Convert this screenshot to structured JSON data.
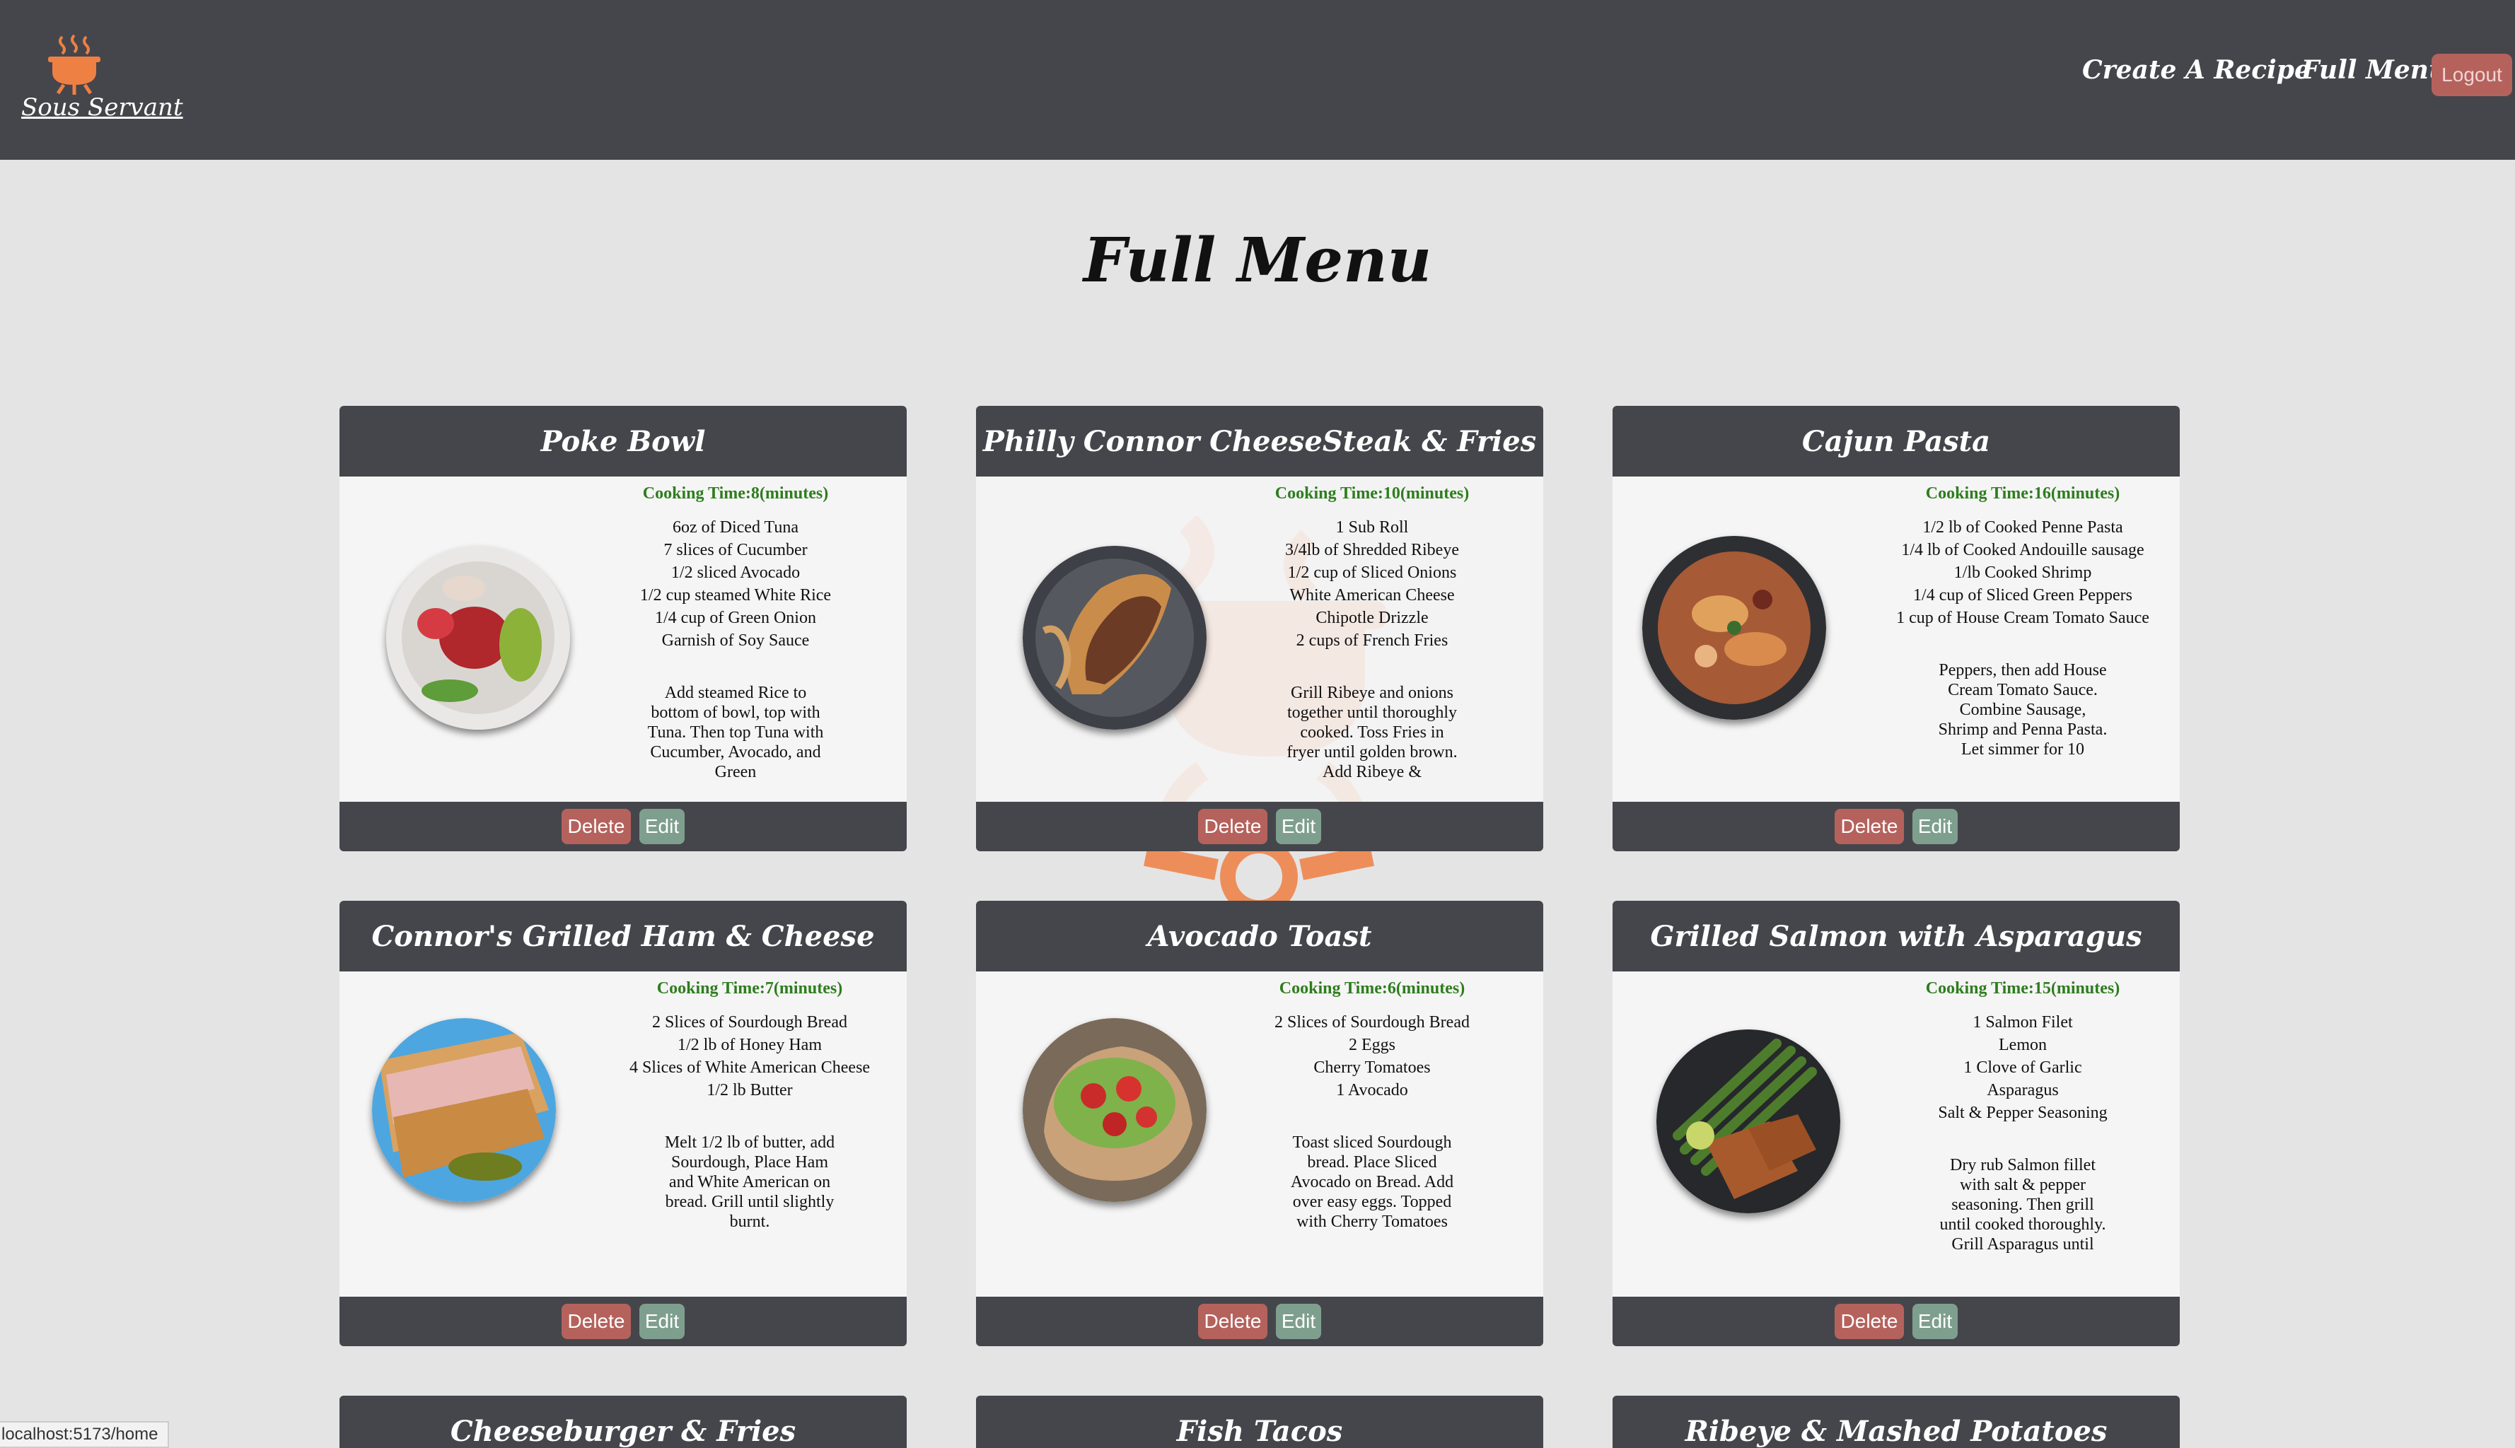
{
  "navbar": {
    "brand": "Sous Servant",
    "links": [
      "Create A Recipe",
      "Full Menu"
    ],
    "logout": "Logout"
  },
  "page": {
    "title": "Full Menu"
  },
  "colors": {
    "navbar": "#45464b",
    "accent": "#ef8043",
    "delete": "#b5625d",
    "edit": "#7f9f8e",
    "cooking_time": "#2e7d1e"
  },
  "buttons": {
    "delete": "Delete",
    "edit": "Edit"
  },
  "recipes": [
    {
      "title": "Poke Bowl",
      "cooking_time": "Cooking Time:8(minutes)",
      "ingredients": [
        "6oz of Diced Tuna",
        "7 slices of Cucumber",
        "1/2 sliced Avocado",
        "1/2 cup steamed White Rice",
        "1/4 cup of Green Onion",
        "Garnish of Soy Sauce"
      ],
      "instructions": "Add steamed Rice to bottom of bowl, top with Tuna. Then top Tuna with Cucumber, Avocado, and Green"
    },
    {
      "title": "Philly Connor CheeseSteak & Fries",
      "cooking_time": "Cooking Time:10(minutes)",
      "ingredients": [
        "1 Sub Roll",
        "3/4lb of Shredded Ribeye",
        "1/2 cup of Sliced Onions",
        "White American Cheese",
        "Chipotle Drizzle",
        "2 cups of French Fries"
      ],
      "instructions": "Grill Ribeye and onions together until thoroughly cooked. Toss Fries in fryer until golden brown. Add Ribeye &"
    },
    {
      "title": "Cajun Pasta",
      "cooking_time": "Cooking Time:16(minutes)",
      "ingredients": [
        "1/2 lb of Cooked Penne Pasta",
        "1/4 lb of Cooked Andouille sausage",
        "1/lb Cooked Shrimp",
        "1/4 cup of Sliced Green Peppers",
        "1 cup of House Cream Tomato Sauce"
      ],
      "instructions": "Peppers, then add House Cream Tomato Sauce. Combine Sausage, Shrimp and Penna Pasta. Let simmer for 10"
    },
    {
      "title": "Connor's Grilled Ham & Cheese",
      "cooking_time": "Cooking Time:7(minutes)",
      "ingredients": [
        "2 Slices of Sourdough Bread",
        "1/2 lb of Honey Ham",
        "4 Slices of White American Cheese",
        "1/2 lb Butter"
      ],
      "instructions": "Melt 1/2 lb of butter, add Sourdough, Place Ham and White American on bread. Grill until slightly burnt."
    },
    {
      "title": "Avocado Toast",
      "cooking_time": "Cooking Time:6(minutes)",
      "ingredients": [
        "2 Slices of Sourdough Bread",
        "2 Eggs",
        "Cherry Tomatoes",
        "1 Avocado"
      ],
      "instructions": "Toast sliced Sourdough bread. Place Sliced Avocado on Bread. Add over easy eggs. Topped with Cherry Tomatoes"
    },
    {
      "title": "Grilled Salmon with Asparagus",
      "cooking_time": "Cooking Time:15(minutes)",
      "ingredients": [
        "1 Salmon Filet",
        "Lemon",
        "1 Clove of Garlic",
        "Asparagus",
        "Salt & Pepper Seasoning"
      ],
      "instructions": "Dry rub Salmon fillet with salt & pepper seasoning. Then grill until cooked thoroughly. Grill Asparagus until"
    },
    {
      "title": "Cheeseburger & Fries"
    },
    {
      "title": "Fish Tacos"
    },
    {
      "title": "Ribeye & Mashed Potatoes"
    }
  ],
  "status_bar": {
    "url": "localhost:5173/home"
  }
}
